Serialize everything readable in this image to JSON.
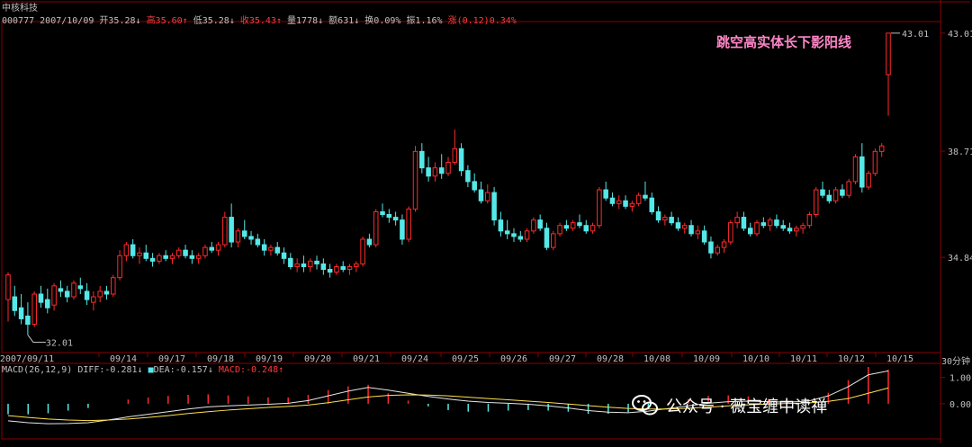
{
  "header": {
    "stock_name": "中核科技",
    "code": "000777",
    "date": "2007/10/09",
    "open": "开35.28↓",
    "high": "高35.60↑",
    "low": "低35.28↓",
    "close": "收35.43↑",
    "volume": "量1778↓",
    "amount": "额631↓",
    "turnover": "换0.09%",
    "amplitude": "振1.16%",
    "change": "涨(0.12)0.34%"
  },
  "annotation": "跳空高实体长下影阳线",
  "period_label": "30分钟",
  "macd_header": {
    "name": "MACD(26,12,9)",
    "diff": "DIFF:-0.281↓",
    "dea": "DEA:-0.157↓",
    "macd": "MACD:-0.248↑"
  },
  "watermark": "公众号 · 薇宝缠中读禅",
  "colors": {
    "up": "#ff2a2a",
    "down": "#55e8e8",
    "frame": "#8b0000",
    "text": "#c0c0c0"
  },
  "chart_data": {
    "type": "candlestick",
    "price_ylim": [
      31.5,
      43.3
    ],
    "price_ticks": [
      "43.01",
      "38.71",
      "34.84"
    ],
    "low_marker": "32.01",
    "high_marker": "43.01",
    "x_date_labels": [
      "2007/09/11",
      "09/14",
      "09/17",
      "09/18",
      "09/19",
      "09/20",
      "09/21",
      "09/24",
      "09/25",
      "09/26",
      "09/27",
      "09/28",
      "10/08",
      "10/09",
      "10/10",
      "10/11",
      "10/12",
      "10/15"
    ],
    "candles": [
      [
        33.3,
        34.3,
        32.5,
        34.2
      ],
      [
        33.4,
        33.8,
        32.7,
        32.9
      ],
      [
        33.0,
        33.5,
        32.4,
        32.6
      ],
      [
        32.7,
        33.2,
        32.01,
        32.4
      ],
      [
        32.4,
        33.6,
        32.3,
        33.5
      ],
      [
        33.5,
        33.8,
        33.0,
        33.2
      ],
      [
        33.3,
        33.7,
        32.8,
        33.0
      ],
      [
        33.1,
        33.9,
        32.9,
        33.8
      ],
      [
        33.7,
        34.0,
        33.4,
        33.6
      ],
      [
        33.6,
        33.8,
        33.2,
        33.4
      ],
      [
        33.4,
        34.0,
        33.3,
        33.9
      ],
      [
        33.8,
        34.1,
        33.5,
        33.7
      ],
      [
        33.6,
        33.9,
        33.1,
        33.3
      ],
      [
        33.2,
        33.6,
        32.9,
        33.4
      ],
      [
        33.4,
        33.8,
        33.2,
        33.6
      ],
      [
        33.6,
        33.8,
        33.3,
        33.5
      ],
      [
        33.5,
        34.2,
        33.4,
        34.1
      ],
      [
        34.1,
        35.1,
        34.0,
        34.9
      ],
      [
        34.9,
        35.4,
        34.7,
        35.3
      ],
      [
        35.3,
        35.5,
        34.8,
        34.9
      ],
      [
        34.9,
        35.2,
        34.6,
        35.0
      ],
      [
        35.0,
        35.3,
        34.7,
        34.8
      ],
      [
        34.8,
        35.0,
        34.5,
        34.7
      ],
      [
        34.7,
        35.0,
        34.6,
        34.9
      ],
      [
        34.9,
        35.1,
        34.7,
        34.8
      ],
      [
        34.8,
        35.0,
        34.6,
        34.9
      ],
      [
        34.9,
        35.2,
        34.8,
        35.1
      ],
      [
        35.1,
        35.3,
        34.8,
        34.9
      ],
      [
        34.9,
        35.1,
        34.6,
        34.8
      ],
      [
        34.8,
        35.0,
        34.6,
        34.9
      ],
      [
        34.9,
        35.3,
        34.8,
        35.2
      ],
      [
        35.2,
        35.4,
        35.0,
        35.1
      ],
      [
        35.1,
        35.4,
        34.9,
        35.3
      ],
      [
        35.3,
        36.5,
        35.2,
        36.3
      ],
      [
        36.3,
        36.8,
        35.2,
        35.4
      ],
      [
        35.4,
        35.9,
        35.2,
        35.8
      ],
      [
        35.8,
        36.2,
        35.5,
        35.6
      ],
      [
        35.6,
        35.8,
        35.3,
        35.5
      ],
      [
        35.5,
        35.7,
        35.2,
        35.3
      ],
      [
        35.3,
        35.5,
        34.9,
        35.1
      ],
      [
        35.1,
        35.3,
        34.9,
        35.2
      ],
      [
        35.2,
        35.4,
        34.9,
        35.0
      ],
      [
        35.0,
        35.2,
        34.6,
        34.8
      ],
      [
        34.8,
        35.0,
        34.4,
        34.5
      ],
      [
        34.5,
        34.8,
        34.3,
        34.6
      ],
      [
        34.6,
        34.9,
        34.3,
        34.5
      ],
      [
        34.5,
        34.8,
        34.3,
        34.7
      ],
      [
        34.7,
        34.9,
        34.4,
        34.6
      ],
      [
        34.6,
        34.8,
        34.2,
        34.4
      ],
      [
        34.4,
        34.6,
        34.1,
        34.3
      ],
      [
        34.3,
        34.6,
        34.2,
        34.5
      ],
      [
        34.5,
        34.7,
        34.3,
        34.4
      ],
      [
        34.4,
        34.6,
        34.2,
        34.5
      ],
      [
        34.5,
        34.7,
        34.3,
        34.6
      ],
      [
        34.6,
        35.6,
        34.5,
        35.5
      ],
      [
        35.5,
        35.7,
        35.2,
        35.3
      ],
      [
        35.3,
        36.6,
        35.2,
        36.5
      ],
      [
        36.5,
        36.8,
        36.3,
        36.4
      ],
      [
        36.4,
        36.6,
        36.1,
        36.3
      ],
      [
        36.3,
        36.5,
        36.0,
        36.2
      ],
      [
        36.2,
        36.4,
        35.3,
        35.5
      ],
      [
        35.5,
        36.7,
        35.4,
        36.6
      ],
      [
        36.6,
        38.9,
        36.5,
        38.7
      ],
      [
        38.7,
        39.0,
        37.9,
        38.1
      ],
      [
        38.1,
        38.5,
        37.6,
        37.8
      ],
      [
        37.8,
        38.3,
        37.6,
        38.1
      ],
      [
        38.1,
        38.6,
        37.7,
        37.9
      ],
      [
        37.9,
        38.5,
        37.8,
        38.3
      ],
      [
        38.3,
        39.5,
        38.2,
        38.8
      ],
      [
        38.8,
        39.0,
        37.8,
        38.0
      ],
      [
        38.0,
        38.2,
        37.4,
        37.6
      ],
      [
        37.6,
        37.9,
        37.2,
        37.3
      ],
      [
        37.3,
        37.6,
        36.8,
        36.9
      ],
      [
        36.9,
        37.5,
        36.8,
        37.2
      ],
      [
        37.2,
        37.4,
        36.0,
        36.2
      ],
      [
        36.2,
        36.5,
        35.6,
        35.8
      ],
      [
        35.8,
        36.2,
        35.5,
        35.7
      ],
      [
        35.7,
        35.9,
        35.4,
        35.6
      ],
      [
        35.6,
        35.8,
        35.4,
        35.5
      ],
      [
        35.5,
        35.9,
        35.4,
        35.8
      ],
      [
        35.8,
        36.3,
        35.7,
        36.2
      ],
      [
        36.2,
        36.4,
        35.8,
        35.9
      ],
      [
        35.9,
        36.1,
        35.1,
        35.2
      ],
      [
        35.2,
        35.8,
        35.1,
        35.7
      ],
      [
        35.7,
        36.1,
        35.6,
        36.0
      ],
      [
        36.0,
        36.2,
        35.8,
        35.9
      ],
      [
        35.9,
        36.2,
        35.8,
        36.1
      ],
      [
        36.1,
        36.4,
        35.9,
        36.0
      ],
      [
        36.0,
        36.2,
        35.7,
        35.8
      ],
      [
        35.8,
        36.1,
        35.7,
        36.0
      ],
      [
        36.0,
        37.4,
        35.9,
        37.3
      ],
      [
        37.3,
        37.6,
        36.9,
        37.0
      ],
      [
        37.0,
        37.2,
        36.7,
        36.8
      ],
      [
        36.8,
        37.1,
        36.6,
        36.9
      ],
      [
        36.9,
        37.1,
        36.6,
        36.7
      ],
      [
        36.7,
        36.9,
        36.5,
        36.8
      ],
      [
        36.8,
        37.2,
        36.7,
        37.1
      ],
      [
        37.1,
        37.6,
        36.9,
        37.0
      ],
      [
        37.0,
        37.2,
        36.4,
        36.5
      ],
      [
        36.5,
        36.7,
        36.1,
        36.2
      ],
      [
        36.2,
        36.4,
        36.0,
        36.3
      ],
      [
        36.3,
        36.5,
        36.0,
        36.1
      ],
      [
        36.1,
        36.3,
        35.8,
        35.9
      ],
      [
        35.9,
        36.1,
        35.7,
        36.0
      ],
      [
        36.0,
        36.2,
        35.6,
        35.7
      ],
      [
        35.7,
        36.0,
        35.5,
        35.8
      ],
      [
        35.8,
        36.0,
        35.3,
        35.4
      ],
      [
        35.4,
        35.6,
        34.8,
        35.0
      ],
      [
        35.0,
        35.3,
        34.9,
        35.2
      ],
      [
        35.2,
        35.5,
        35.0,
        35.4
      ],
      [
        35.4,
        36.2,
        35.3,
        36.1
      ],
      [
        36.1,
        36.5,
        35.9,
        36.3
      ],
      [
        36.3,
        36.5,
        35.8,
        35.9
      ],
      [
        35.9,
        36.1,
        35.6,
        35.7
      ],
      [
        35.7,
        36.2,
        35.6,
        36.1
      ],
      [
        36.1,
        36.3,
        35.9,
        36.0
      ],
      [
        36.0,
        36.3,
        35.8,
        36.2
      ],
      [
        36.2,
        36.4,
        35.9,
        36.0
      ],
      [
        36.0,
        36.2,
        35.8,
        35.9
      ],
      [
        35.9,
        36.1,
        35.7,
        35.8
      ],
      [
        35.8,
        36.0,
        35.6,
        35.9
      ],
      [
        35.9,
        36.1,
        35.7,
        36.0
      ],
      [
        36.0,
        36.5,
        35.9,
        36.4
      ],
      [
        36.4,
        37.4,
        36.3,
        37.3
      ],
      [
        37.3,
        37.6,
        37.0,
        37.1
      ],
      [
        37.1,
        37.3,
        36.8,
        36.9
      ],
      [
        36.9,
        37.4,
        36.8,
        37.3
      ],
      [
        37.3,
        37.5,
        37.0,
        37.1
      ],
      [
        37.1,
        37.7,
        37.0,
        37.6
      ],
      [
        37.6,
        38.6,
        37.5,
        38.5
      ],
      [
        38.5,
        39.0,
        37.2,
        37.4
      ],
      [
        37.4,
        38.0,
        37.3,
        37.9
      ],
      [
        37.9,
        38.8,
        37.8,
        38.7
      ],
      [
        38.7,
        39.0,
        38.5,
        38.9
      ],
      [
        41.5,
        43.01,
        40.0,
        43.01
      ]
    ],
    "macd": {
      "ylim": [
        -1.2,
        1.4
      ],
      "ticks": [
        "1.00",
        "0.00"
      ],
      "diff": [
        -0.65,
        -0.72,
        -0.76,
        -0.75,
        -0.72,
        -0.62,
        -0.5,
        -0.4,
        -0.3,
        -0.2,
        -0.12,
        -0.08,
        -0.05,
        -0.02,
        0.02,
        0.12,
        0.3,
        0.48,
        0.62,
        0.52,
        0.4,
        0.28,
        0.18,
        0.1,
        0.05,
        0.02,
        -0.02,
        -0.08,
        -0.16,
        -0.26,
        -0.32,
        -0.34,
        -0.28,
        -0.18,
        -0.08,
        0.02,
        0.08,
        0.1,
        0.08,
        0.06,
        0.1,
        0.3,
        0.65,
        1.1,
        1.25
      ],
      "dea": [
        -0.45,
        -0.52,
        -0.58,
        -0.62,
        -0.64,
        -0.62,
        -0.58,
        -0.52,
        -0.45,
        -0.37,
        -0.3,
        -0.24,
        -0.19,
        -0.14,
        -0.1,
        -0.05,
        0.04,
        0.15,
        0.26,
        0.32,
        0.34,
        0.33,
        0.3,
        0.25,
        0.2,
        0.15,
        0.1,
        0.05,
        -0.01,
        -0.07,
        -0.13,
        -0.18,
        -0.2,
        -0.2,
        -0.17,
        -0.13,
        -0.08,
        -0.04,
        -0.01,
        0.01,
        0.03,
        0.09,
        0.2,
        0.4,
        0.6
      ]
    }
  }
}
